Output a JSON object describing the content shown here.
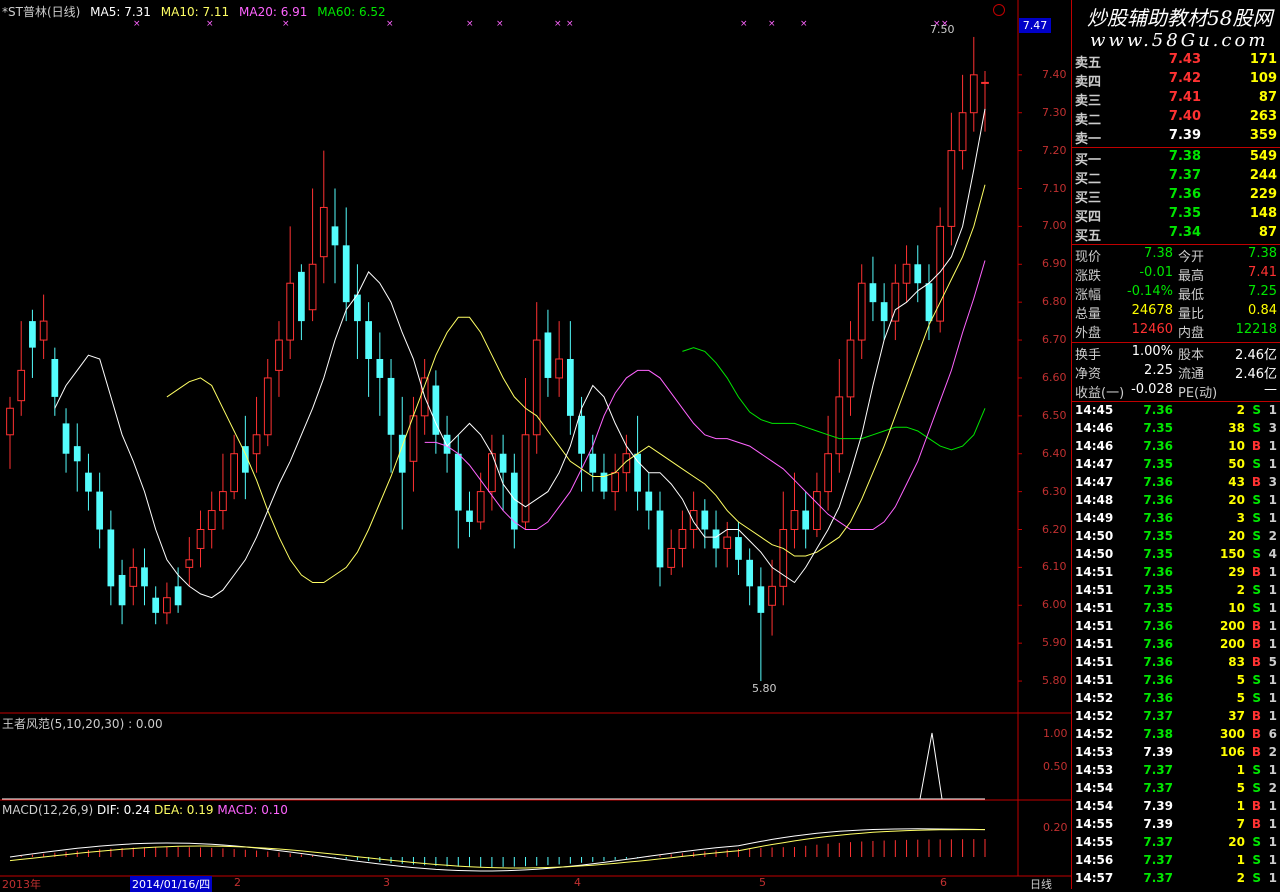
{
  "header": {
    "stock": "*ST普林(日线)",
    "ma5": "MA5: 7.31",
    "ma10": "MA10: 7.11",
    "ma20": "MA20: 6.91",
    "ma60": "MA60: 6.52"
  },
  "price_box": "7.47",
  "watermark": {
    "line1": "炒股辅助教材58股网",
    "line2": "www.58Gu.com"
  },
  "y_axis": [
    "7.40",
    "7.30",
    "7.20",
    "7.10",
    "7.00",
    "6.90",
    "6.80",
    "6.70",
    "6.60",
    "6.50",
    "6.40",
    "6.30",
    "6.20",
    "6.10",
    "6.00",
    "5.90",
    "5.80"
  ],
  "high_label": "7.50",
  "low_label": "5.80",
  "indicator1": {
    "title": "王者风范(5,10,20,30) : 0.00",
    "ticks": [
      "1.00",
      "0.50"
    ]
  },
  "macd": {
    "title_main": "MACD(12,26,9)",
    "dif": "DIF: 0.24",
    "dea": "DEA: 0.19",
    "macd": "MACD: 0.10",
    "tick": "0.20"
  },
  "x_axis": {
    "year": "2013年",
    "cursor_date": "2014/01/16/四",
    "m2": "2",
    "m3": "3",
    "m4": "4",
    "m5": "5",
    "m6": "6",
    "period": "日线"
  },
  "orderbook": {
    "asks": [
      {
        "label": "卖五",
        "price": "7.43",
        "vol": "171"
      },
      {
        "label": "卖四",
        "price": "7.42",
        "vol": "109"
      },
      {
        "label": "卖三",
        "price": "7.41",
        "vol": "87"
      },
      {
        "label": "卖二",
        "price": "7.40",
        "vol": "263"
      },
      {
        "label": "卖一",
        "price": "7.39",
        "vol": "359"
      }
    ],
    "bids": [
      {
        "label": "买一",
        "price": "7.38",
        "vol": "549"
      },
      {
        "label": "买二",
        "price": "7.37",
        "vol": "244"
      },
      {
        "label": "买三",
        "price": "7.36",
        "vol": "229"
      },
      {
        "label": "买四",
        "price": "7.35",
        "vol": "148"
      },
      {
        "label": "买五",
        "price": "7.34",
        "vol": "87"
      }
    ]
  },
  "quote": [
    {
      "l1": "现价",
      "v1": "7.38",
      "l2": "今开",
      "v2": "7.38"
    },
    {
      "l1": "涨跌",
      "v1": "-0.01",
      "l2": "最高",
      "v2": "7.41"
    },
    {
      "l1": "涨幅",
      "v1": "-0.14%",
      "l2": "最低",
      "v2": "7.25"
    },
    {
      "l1": "总量",
      "v1": "24678",
      "l2": "量比",
      "v2": "0.84"
    },
    {
      "l1": "外盘",
      "v1": "12460",
      "l2": "内盘",
      "v2": "12218"
    }
  ],
  "fund": [
    {
      "l1": "换手",
      "v1": "1.00%",
      "l2": "股本",
      "v2": "2.46亿"
    },
    {
      "l1": "净资",
      "v1": "2.25",
      "l2": "流通",
      "v2": "2.46亿"
    },
    {
      "l1": "收益(一)",
      "v1": "-0.028",
      "l2": "PE(动)",
      "v2": "—"
    }
  ],
  "ticks": [
    {
      "t": "14:45",
      "p": "7.36",
      "v": "2",
      "s": "S",
      "n": "1"
    },
    {
      "t": "14:46",
      "p": "7.35",
      "v": "38",
      "s": "S",
      "n": "3"
    },
    {
      "t": "14:46",
      "p": "7.36",
      "v": "10",
      "s": "B",
      "n": "1"
    },
    {
      "t": "14:47",
      "p": "7.35",
      "v": "50",
      "s": "S",
      "n": "1"
    },
    {
      "t": "14:47",
      "p": "7.36",
      "v": "43",
      "s": "B",
      "n": "3"
    },
    {
      "t": "14:48",
      "p": "7.36",
      "v": "20",
      "s": "S",
      "n": "1"
    },
    {
      "t": "14:49",
      "p": "7.36",
      "v": "3",
      "s": "S",
      "n": "1"
    },
    {
      "t": "14:50",
      "p": "7.35",
      "v": "20",
      "s": "S",
      "n": "2"
    },
    {
      "t": "14:50",
      "p": "7.35",
      "v": "150",
      "s": "S",
      "n": "4"
    },
    {
      "t": "14:51",
      "p": "7.36",
      "v": "29",
      "s": "B",
      "n": "1"
    },
    {
      "t": "14:51",
      "p": "7.35",
      "v": "2",
      "s": "S",
      "n": "1"
    },
    {
      "t": "14:51",
      "p": "7.35",
      "v": "10",
      "s": "S",
      "n": "1"
    },
    {
      "t": "14:51",
      "p": "7.36",
      "v": "200",
      "s": "B",
      "n": "1"
    },
    {
      "t": "14:51",
      "p": "7.36",
      "v": "200",
      "s": "B",
      "n": "1"
    },
    {
      "t": "14:51",
      "p": "7.36",
      "v": "83",
      "s": "B",
      "n": "5"
    },
    {
      "t": "14:51",
      "p": "7.36",
      "v": "5",
      "s": "S",
      "n": "1"
    },
    {
      "t": "14:52",
      "p": "7.36",
      "v": "5",
      "s": "S",
      "n": "1"
    },
    {
      "t": "14:52",
      "p": "7.37",
      "v": "37",
      "s": "B",
      "n": "1"
    },
    {
      "t": "14:52",
      "p": "7.38",
      "v": "300",
      "s": "B",
      "n": "6"
    },
    {
      "t": "14:53",
      "p": "7.39",
      "v": "106",
      "s": "B",
      "n": "2"
    },
    {
      "t": "14:53",
      "p": "7.37",
      "v": "1",
      "s": "S",
      "n": "1"
    },
    {
      "t": "14:54",
      "p": "7.37",
      "v": "5",
      "s": "S",
      "n": "2"
    },
    {
      "t": "14:54",
      "p": "7.39",
      "v": "1",
      "s": "B",
      "n": "1"
    },
    {
      "t": "14:55",
      "p": "7.39",
      "v": "7",
      "s": "B",
      "n": "1"
    },
    {
      "t": "14:55",
      "p": "7.37",
      "v": "20",
      "s": "S",
      "n": "1"
    },
    {
      "t": "14:56",
      "p": "7.37",
      "v": "1",
      "s": "S",
      "n": "1"
    },
    {
      "t": "14:57",
      "p": "7.37",
      "v": "2",
      "s": "S",
      "n": "1"
    }
  ],
  "colors": {
    "up": "#ff3232",
    "down": "#54fcfc",
    "ma5": "#ffffff",
    "ma10": "#ffff64",
    "ma20": "#ff64ff",
    "ma60": "#00e600",
    "grid": "#c00000",
    "buy": "#ff3232",
    "sell": "#00e600"
  },
  "chart_data": {
    "type": "candlestick",
    "ylim": [
      5.75,
      7.55
    ],
    "candles": [
      [
        6.45,
        6.52,
        6.36,
        6.55
      ],
      [
        6.54,
        6.62,
        6.5,
        6.75
      ],
      [
        6.75,
        6.68,
        6.6,
        6.78
      ],
      [
        6.7,
        6.75,
        6.65,
        6.82
      ],
      [
        6.65,
        6.55,
        6.5,
        6.68
      ],
      [
        6.48,
        6.4,
        6.35,
        6.52
      ],
      [
        6.42,
        6.38,
        6.3,
        6.48
      ],
      [
        6.35,
        6.3,
        6.25,
        6.4
      ],
      [
        6.3,
        6.2,
        6.15,
        6.35
      ],
      [
        6.2,
        6.05,
        6.0,
        6.25
      ],
      [
        6.08,
        6.0,
        5.95,
        6.12
      ],
      [
        6.05,
        6.1,
        6.0,
        6.15
      ],
      [
        6.1,
        6.05,
        6.0,
        6.15
      ],
      [
        6.02,
        5.98,
        5.95,
        6.05
      ],
      [
        5.98,
        6.02,
        5.95,
        6.06
      ],
      [
        6.05,
        6.0,
        5.98,
        6.1
      ],
      [
        6.1,
        6.12,
        6.05,
        6.18
      ],
      [
        6.15,
        6.2,
        6.1,
        6.25
      ],
      [
        6.2,
        6.25,
        6.15,
        6.3
      ],
      [
        6.25,
        6.3,
        6.2,
        6.4
      ],
      [
        6.3,
        6.4,
        6.28,
        6.45
      ],
      [
        6.42,
        6.35,
        6.28,
        6.5
      ],
      [
        6.4,
        6.45,
        6.35,
        6.55
      ],
      [
        6.45,
        6.6,
        6.42,
        6.65
      ],
      [
        6.62,
        6.7,
        6.55,
        6.75
      ],
      [
        6.7,
        6.85,
        6.65,
        7.0
      ],
      [
        6.88,
        6.75,
        6.7,
        6.9
      ],
      [
        6.78,
        6.9,
        6.75,
        7.1
      ],
      [
        6.92,
        7.05,
        6.85,
        7.2
      ],
      [
        7.0,
        6.95,
        6.85,
        7.1
      ],
      [
        6.95,
        6.8,
        6.75,
        7.05
      ],
      [
        6.82,
        6.75,
        6.65,
        6.9
      ],
      [
        6.75,
        6.65,
        6.55,
        6.8
      ],
      [
        6.65,
        6.6,
        6.5,
        6.72
      ],
      [
        6.6,
        6.45,
        6.35,
        6.65
      ],
      [
        6.45,
        6.35,
        6.2,
        6.55
      ],
      [
        6.38,
        6.5,
        6.3,
        6.55
      ],
      [
        6.5,
        6.6,
        6.45,
        6.65
      ],
      [
        6.58,
        6.45,
        6.4,
        6.62
      ],
      [
        6.45,
        6.4,
        6.35,
        6.5
      ],
      [
        6.4,
        6.25,
        6.15,
        6.45
      ],
      [
        6.25,
        6.22,
        6.18,
        6.3
      ],
      [
        6.22,
        6.3,
        6.2,
        6.35
      ],
      [
        6.3,
        6.4,
        6.25,
        6.45
      ],
      [
        6.4,
        6.35,
        6.25,
        6.45
      ],
      [
        6.35,
        6.2,
        6.15,
        6.4
      ],
      [
        6.22,
        6.45,
        6.2,
        6.6
      ],
      [
        6.45,
        6.7,
        6.4,
        6.8
      ],
      [
        6.72,
        6.6,
        6.55,
        6.78
      ],
      [
        6.6,
        6.65,
        6.55,
        6.75
      ],
      [
        6.65,
        6.5,
        6.45,
        6.75
      ],
      [
        6.5,
        6.4,
        6.3,
        6.55
      ],
      [
        6.4,
        6.35,
        6.3,
        6.45
      ],
      [
        6.35,
        6.3,
        6.28,
        6.4
      ],
      [
        6.3,
        6.35,
        6.25,
        6.4
      ],
      [
        6.35,
        6.4,
        6.3,
        6.45
      ],
      [
        6.4,
        6.3,
        6.25,
        6.5
      ],
      [
        6.3,
        6.25,
        6.2,
        6.35
      ],
      [
        6.25,
        6.1,
        6.05,
        6.3
      ],
      [
        6.1,
        6.15,
        6.08,
        6.2
      ],
      [
        6.15,
        6.2,
        6.1,
        6.25
      ],
      [
        6.2,
        6.25,
        6.15,
        6.3
      ],
      [
        6.25,
        6.2,
        6.15,
        6.28
      ],
      [
        6.2,
        6.15,
        6.1,
        6.25
      ],
      [
        6.15,
        6.18,
        6.1,
        6.22
      ],
      [
        6.18,
        6.12,
        6.08,
        6.22
      ],
      [
        6.12,
        6.05,
        6.0,
        6.15
      ],
      [
        6.05,
        5.98,
        5.8,
        6.1
      ],
      [
        6.0,
        6.05,
        5.92,
        6.12
      ],
      [
        6.05,
        6.2,
        6.0,
        6.3
      ],
      [
        6.2,
        6.25,
        6.15,
        6.35
      ],
      [
        6.25,
        6.2,
        6.15,
        6.3
      ],
      [
        6.2,
        6.3,
        6.18,
        6.35
      ],
      [
        6.3,
        6.4,
        6.25,
        6.5
      ],
      [
        6.4,
        6.55,
        6.35,
        6.65
      ],
      [
        6.55,
        6.7,
        6.5,
        6.75
      ],
      [
        6.7,
        6.85,
        6.65,
        6.9
      ],
      [
        6.85,
        6.8,
        6.75,
        6.92
      ],
      [
        6.8,
        6.75,
        6.7,
        6.85
      ],
      [
        6.75,
        6.85,
        6.7,
        6.9
      ],
      [
        6.85,
        6.9,
        6.8,
        6.95
      ],
      [
        6.9,
        6.85,
        6.8,
        6.95
      ],
      [
        6.85,
        6.75,
        6.7,
        6.9
      ],
      [
        6.75,
        7.0,
        6.72,
        7.05
      ],
      [
        7.0,
        7.2,
        6.95,
        7.3
      ],
      [
        7.2,
        7.3,
        7.15,
        7.4
      ],
      [
        7.3,
        7.4,
        7.25,
        7.5
      ],
      [
        7.38,
        7.38,
        7.25,
        7.41
      ]
    ],
    "ma5": [
      6.52,
      6.58,
      6.62,
      6.66,
      6.65,
      6.55,
      6.45,
      6.38,
      6.3,
      6.2,
      6.12,
      6.08,
      6.05,
      6.03,
      6.02,
      6.04,
      6.08,
      6.12,
      6.18,
      6.25,
      6.32,
      6.38,
      6.45,
      6.52,
      6.6,
      6.7,
      6.78,
      6.82,
      6.88,
      6.85,
      6.8,
      6.72,
      6.65,
      6.55,
      6.48,
      6.42,
      6.45,
      6.48,
      6.45,
      6.4,
      6.32,
      6.28,
      6.26,
      6.28,
      6.3,
      6.35,
      6.42,
      6.52,
      6.58,
      6.55,
      6.48,
      6.42,
      6.38,
      6.35,
      6.35,
      6.32,
      6.28,
      6.22,
      6.18,
      6.18,
      6.2,
      6.2,
      6.17,
      6.14,
      6.1,
      6.08,
      6.06,
      6.1,
      6.15,
      6.2,
      6.26,
      6.35,
      6.45,
      6.58,
      6.7,
      6.78,
      6.8,
      6.83,
      6.85,
      6.88,
      6.92,
      7.0,
      7.15,
      7.31
    ],
    "ma10": [
      6.55,
      6.57,
      6.59,
      6.6,
      6.58,
      6.52,
      6.46,
      6.4,
      6.33,
      6.25,
      6.18,
      6.12,
      6.08,
      6.06,
      6.06,
      6.08,
      6.1,
      6.14,
      6.2,
      6.27,
      6.34,
      6.42,
      6.5,
      6.58,
      6.66,
      6.72,
      6.76,
      6.76,
      6.72,
      6.66,
      6.6,
      6.55,
      6.52,
      6.5,
      6.46,
      6.42,
      6.38,
      6.36,
      6.34,
      6.34,
      6.35,
      6.38,
      6.4,
      6.42,
      6.4,
      6.38,
      6.36,
      6.34,
      6.32,
      6.29,
      6.25,
      6.22,
      6.2,
      6.18,
      6.16,
      6.15,
      6.13,
      6.13,
      6.14,
      6.16,
      6.18,
      6.22,
      6.28,
      6.35,
      6.42,
      6.5,
      6.58,
      6.66,
      6.74,
      6.8,
      6.86,
      6.92,
      7.0,
      7.11
    ],
    "ma20": [
      6.43,
      6.43,
      6.42,
      6.4,
      6.37,
      6.33,
      6.29,
      6.25,
      6.22,
      6.2,
      6.2,
      6.22,
      6.26,
      6.3,
      6.36,
      6.42,
      6.5,
      6.56,
      6.6,
      6.62,
      6.62,
      6.6,
      6.56,
      6.52,
      6.48,
      6.45,
      6.44,
      6.44,
      6.43,
      6.42,
      6.4,
      6.38,
      6.36,
      6.33,
      6.3,
      6.27,
      6.24,
      6.22,
      6.2,
      6.2,
      6.2,
      6.22,
      6.26,
      6.32,
      6.38,
      6.46,
      6.54,
      6.62,
      6.72,
      6.81,
      6.91
    ],
    "ma60": [
      6.67,
      6.68,
      6.67,
      6.64,
      6.6,
      6.55,
      6.51,
      6.49,
      6.48,
      6.48,
      6.48,
      6.47,
      6.46,
      6.45,
      6.44,
      6.44,
      6.44,
      6.45,
      6.46,
      6.47,
      6.47,
      6.46,
      6.44,
      6.42,
      6.41,
      6.42,
      6.45,
      6.52
    ]
  }
}
